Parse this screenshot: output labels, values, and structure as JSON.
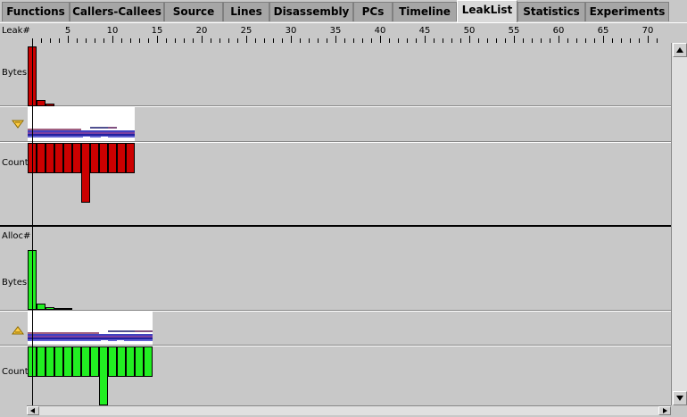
{
  "tabs": [
    {
      "label": "Functions"
    },
    {
      "label": "Callers-Callees"
    },
    {
      "label": "Source"
    },
    {
      "label": "Lines"
    },
    {
      "label": "Disassembly"
    },
    {
      "label": "PCs"
    },
    {
      "label": "Timeline"
    },
    {
      "label": "LeakList"
    },
    {
      "label": "Statistics"
    },
    {
      "label": "Experiments"
    }
  ],
  "active_tab": "LeakList",
  "ruler": {
    "label": "Leak#",
    "ticks": [
      "5",
      "10",
      "15",
      "20",
      "25",
      "30",
      "35",
      "40",
      "45",
      "50",
      "55",
      "60",
      "65",
      "70"
    ]
  },
  "leaks": {
    "bytes_label": "Bytes",
    "count_label": "Count",
    "colors": {
      "bars": "#cc0000"
    }
  },
  "allocs": {
    "header_label": "Alloc#",
    "bytes_label": "Bytes",
    "count_label": "Count",
    "colors": {
      "bars": "#22ee22"
    }
  },
  "icons": [
    "leak-filter-icon",
    "alloc-filter-icon",
    "scroll-up-icon",
    "scroll-down-icon",
    "scroll-left-icon",
    "scroll-right-icon"
  ]
}
